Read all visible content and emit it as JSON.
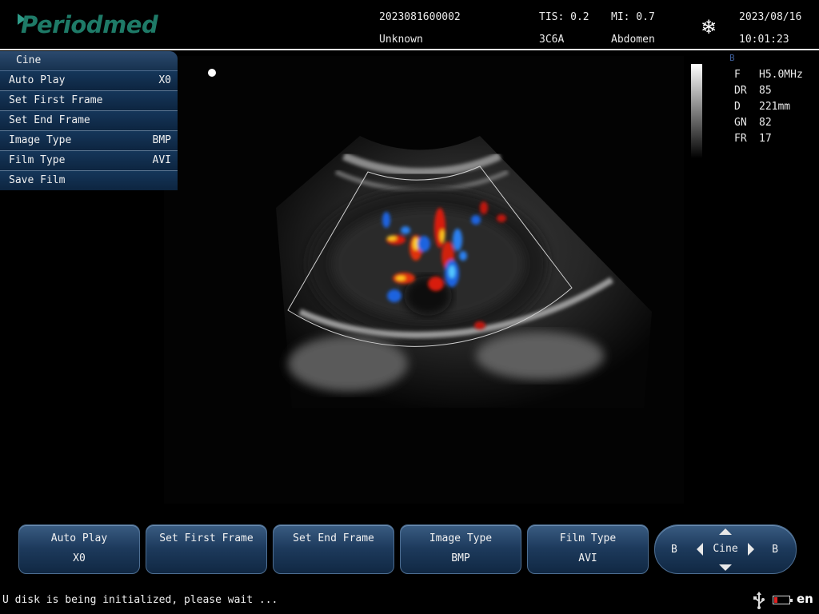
{
  "header": {
    "brand": "Periodmed",
    "patient_id": "2023081600002",
    "patient_name": "Unknown",
    "tis": "TIS: 0.2",
    "probe": "3C6A",
    "mi": "MI: 0.7",
    "exam": "Abdomen",
    "date": "2023/08/16",
    "time": "10:01:23",
    "freeze_icon": "snowflake-icon"
  },
  "cine_menu": {
    "title": "Cine",
    "items": [
      {
        "label": "Auto Play",
        "value": "X0"
      },
      {
        "label": "Set First Frame",
        "value": ""
      },
      {
        "label": "Set End Frame",
        "value": ""
      },
      {
        "label": "Image Type",
        "value": "BMP"
      },
      {
        "label": "Film Type",
        "value": "AVI"
      },
      {
        "label": "Save Film",
        "value": ""
      }
    ]
  },
  "params": {
    "mode": "B",
    "rows": [
      {
        "key": "F",
        "value": "H5.0MHz"
      },
      {
        "key": "DR",
        "value": "85"
      },
      {
        "key": "D",
        "value": "221mm"
      },
      {
        "key": "GN",
        "value": "82"
      },
      {
        "key": "FR",
        "value": "17"
      }
    ]
  },
  "softkeys": [
    {
      "label": "Auto Play",
      "value": "X0"
    },
    {
      "label": "Set First Frame",
      "value": ""
    },
    {
      "label": "Set End Frame",
      "value": ""
    },
    {
      "label": "Image Type",
      "value": "BMP"
    },
    {
      "label": "Film Type",
      "value": "AVI"
    }
  ],
  "nav_pad": {
    "center": "Cine",
    "left": "B",
    "right": "B"
  },
  "status": {
    "message": "U disk is being initialized, please wait ...",
    "language": "en",
    "battery_level": 0.2
  },
  "colors": {
    "menu_bg": "#0f2a47",
    "button_top": "#3a5c82",
    "button_bottom": "#102843",
    "logo": "#1e7a67",
    "doppler_red": "#d81a10",
    "doppler_blue": "#1e64e0"
  }
}
